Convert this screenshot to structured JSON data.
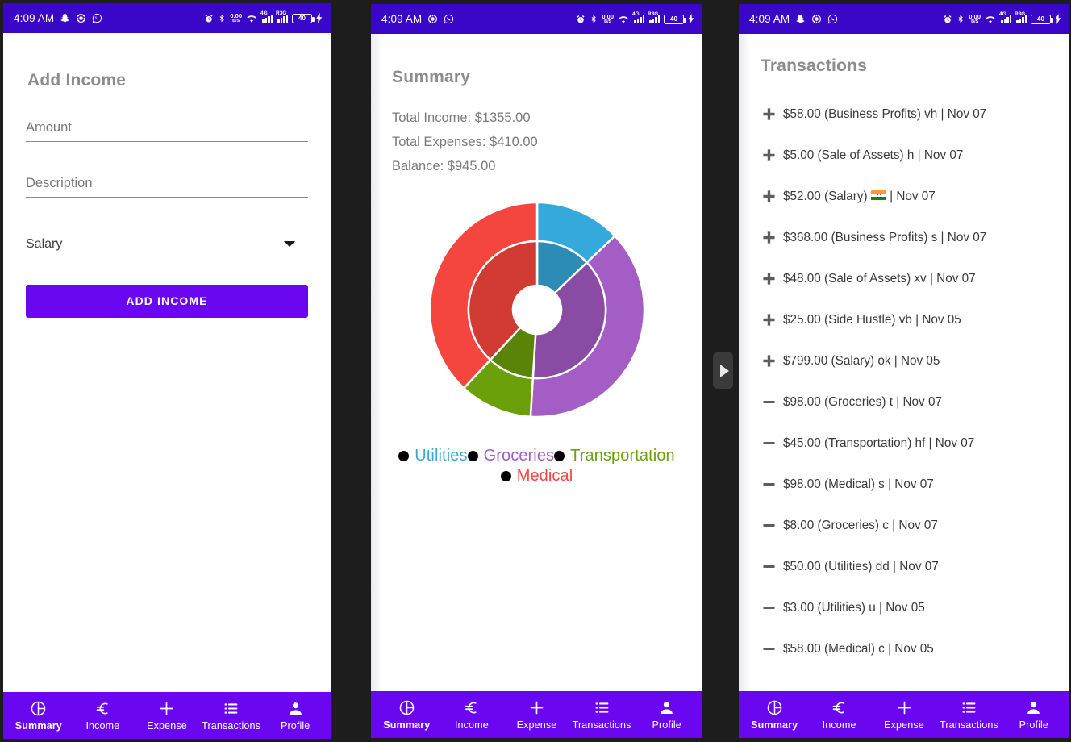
{
  "statusbar": {
    "time": "4:09 AM",
    "battery_level": "40",
    "data_speed_value": "0.00",
    "data_speed_unit": "B/S",
    "signal1_label": "4G",
    "signal2_label": "R3G",
    "left_icons": [
      "snapchat-icon",
      "settings-icon",
      "whatsapp-icon"
    ],
    "right_icons": [
      "alarm-icon",
      "bluetooth-icon",
      "data-speed-icon",
      "wifi-icon",
      "signal-4g-icon",
      "signal-r3g-icon",
      "battery-icon",
      "charging-bolt-icon"
    ],
    "background": "#3a07c8"
  },
  "panel1": {
    "title": "Add Income",
    "amount_placeholder": "Amount",
    "amount_value": "",
    "description_placeholder": "Description",
    "description_value": "",
    "category_selected": "Salary",
    "submit_label": "ADD INCOME",
    "accent": "#6a07f0"
  },
  "panel2": {
    "title": "Summary",
    "total_income": "Total Income: $1355.00",
    "total_expenses": "Total Expenses: $410.00",
    "balance": "Balance: $945.00"
  },
  "chart_data": {
    "type": "pie",
    "title": "Summary",
    "variant": "donut-double-ring",
    "categories": [
      "Utilities",
      "Groceries",
      "Transportation",
      "Medical"
    ],
    "values": [
      53,
      156,
      45,
      156
    ],
    "percentages": [
      12.9,
      38.0,
      11.0,
      38.0
    ],
    "colors": [
      "#36a9dc",
      "#a45dc4",
      "#6ba00a",
      "#f4453f"
    ],
    "inner_ring_colors": [
      "#2d8cb6",
      "#8a4ba4",
      "#598408",
      "#d23a34"
    ],
    "legend": [
      {
        "label": "Utilities",
        "color": "#36a9dc",
        "dot_color": "#000000"
      },
      {
        "label": "Groceries",
        "color": "#a45dc4",
        "dot_color": "#000000"
      },
      {
        "label": "Transportation",
        "color": "#6ba00a",
        "dot_color": "#000000"
      },
      {
        "label": "Medical",
        "color": "#f4453f",
        "dot_color": "#000000"
      }
    ],
    "legend_position": "bottom",
    "start_angle_deg": -90,
    "grid": false,
    "xlabel": "",
    "ylabel": ""
  },
  "panel3": {
    "title": "Transactions",
    "transactions": [
      {
        "sign": "plus",
        "text": "$58.00 (Business Profits) vh | Nov 07",
        "amount": "58.00",
        "category": "Business Profits",
        "note": "vh",
        "date": "Nov 07"
      },
      {
        "sign": "plus",
        "text": "$5.00 (Sale of Assets) h | Nov 07",
        "amount": "5.00",
        "category": "Sale of Assets",
        "note": "h",
        "date": "Nov 07"
      },
      {
        "sign": "plus",
        "text": "$52.00 (Salary) \u0000 | Nov 07",
        "amount": "52.00",
        "category": "Salary",
        "note": "🇮🇳",
        "date": "Nov 07",
        "has_flag": true,
        "prefix": "$52.00 (Salary) ",
        "suffix": " | Nov 07"
      },
      {
        "sign": "plus",
        "text": "$368.00 (Business Profits) s | Nov 07",
        "amount": "368.00",
        "category": "Business Profits",
        "note": "s",
        "date": "Nov 07"
      },
      {
        "sign": "plus",
        "text": "$48.00 (Sale of Assets) xv | Nov 07",
        "amount": "48.00",
        "category": "Sale of Assets",
        "note": "xv",
        "date": "Nov 07"
      },
      {
        "sign": "plus",
        "text": "$25.00 (Side Hustle) vb | Nov 05",
        "amount": "25.00",
        "category": "Side Hustle",
        "note": "vb",
        "date": "Nov 05"
      },
      {
        "sign": "plus",
        "text": "$799.00 (Salary) ok | Nov 05",
        "amount": "799.00",
        "category": "Salary",
        "note": "ok",
        "date": "Nov 05"
      },
      {
        "sign": "minus",
        "text": "$98.00 (Groceries) t | Nov 07",
        "amount": "98.00",
        "category": "Groceries",
        "note": "t",
        "date": "Nov 07"
      },
      {
        "sign": "minus",
        "text": "$45.00 (Transportation) hf | Nov 07",
        "amount": "45.00",
        "category": "Transportation",
        "note": "hf",
        "date": "Nov 07"
      },
      {
        "sign": "minus",
        "text": "$98.00 (Medical) s | Nov 07",
        "amount": "98.00",
        "category": "Medical",
        "note": "s",
        "date": "Nov 07"
      },
      {
        "sign": "minus",
        "text": "$8.00 (Groceries) c | Nov 07",
        "amount": "8.00",
        "category": "Groceries",
        "note": "c",
        "date": "Nov 07"
      },
      {
        "sign": "minus",
        "text": "$50.00 (Utilities) dd | Nov 07",
        "amount": "50.00",
        "category": "Utilities",
        "note": "dd",
        "date": "Nov 07"
      },
      {
        "sign": "minus",
        "text": "$3.00 (Utilities) u | Nov 05",
        "amount": "3.00",
        "category": "Utilities",
        "note": "u",
        "date": "Nov 05"
      },
      {
        "sign": "minus",
        "text": "$58.00 (Medical) c | Nov 05",
        "amount": "58.00",
        "category": "Medical",
        "note": "c",
        "date": "Nov 05"
      }
    ]
  },
  "bottomnav": {
    "active": "Summary",
    "items": [
      {
        "label": "Summary",
        "icon": "pie-chart-icon"
      },
      {
        "label": "Income",
        "icon": "euro-icon"
      },
      {
        "label": "Expense",
        "icon": "plus-icon"
      },
      {
        "label": "Transactions",
        "icon": "list-icon"
      },
      {
        "label": "Profile",
        "icon": "person-icon"
      }
    ],
    "background": "#6a07f0"
  },
  "scroll_tab": {
    "icon": "play-arrow-right-icon"
  }
}
